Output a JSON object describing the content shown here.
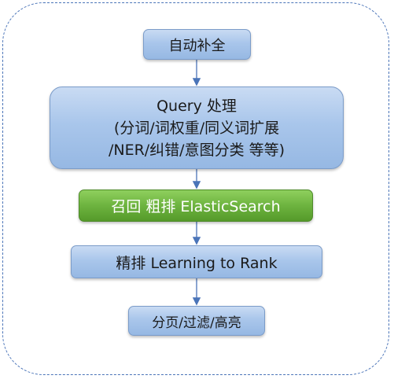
{
  "nodes": {
    "autocomplete": "自动补全",
    "query_line1": "Query 处理",
    "query_line2": "(分词/词权重/同义词扩展",
    "query_line3": "/NER/纠错/意图分类 等等)",
    "recall": "召回 粗排 ElasticSearch",
    "rerank": "精排 Learning to Rank",
    "paging": "分页/过滤/高亮"
  },
  "colors": {
    "node_blue": "#a9c6eb",
    "node_green": "#6db33f",
    "arrow": "#4a74b8",
    "frame": "#4a74b8"
  }
}
